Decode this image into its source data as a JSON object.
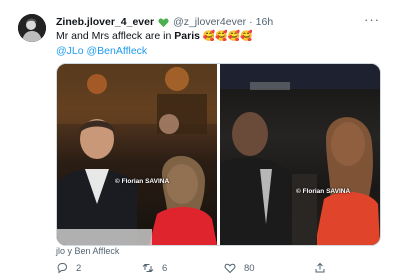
{
  "tweet": {
    "author_name": "Zineb.jlover_4_ever",
    "handle": "@z_jlover4ever",
    "separator": "·",
    "time": "16h",
    "more": "···",
    "text_lead": "Mr and Mrs affleck are in ",
    "text_bold": "Paris",
    "text_emojis": "🥰🥰🥰🥰",
    "mention_1": "@JLo",
    "mention_2": "@BenAffleck",
    "media_caption": "jlo y Ben Affleck",
    "watermark_left": "© Florian SAVINA",
    "watermark_right": "© Florian SAVINA",
    "heart_color": "#4caf50"
  },
  "actions": {
    "reply_count": "2",
    "retweet_count": "6",
    "like_count": "80"
  }
}
